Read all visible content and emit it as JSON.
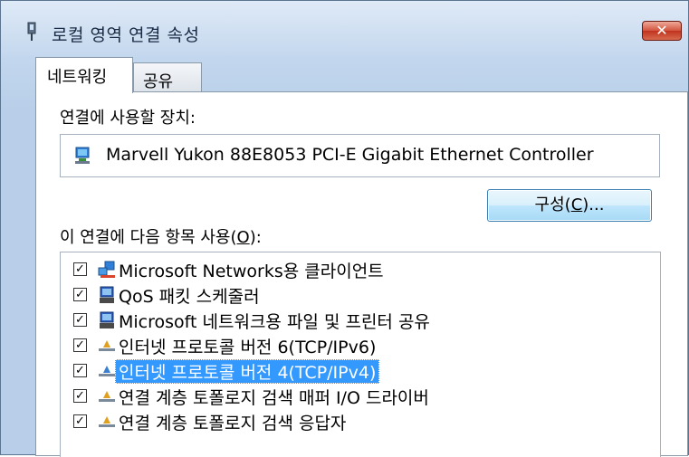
{
  "window": {
    "title": "로컬 영역 연결 속성",
    "close_label": "✕"
  },
  "tabs": [
    {
      "label": "네트워킹",
      "active": true
    },
    {
      "label": "공유",
      "active": false
    }
  ],
  "connection": {
    "device_label": "연결에 사용할 장치:",
    "device_name": "Marvell Yukon 88E8053 PCI-E Gigabit Ethernet Controller",
    "configure_prefix": "구성(",
    "configure_key": "C",
    "configure_suffix": ")..."
  },
  "items_section": {
    "label_prefix": "이 연결에 다음 항목 사용(",
    "label_key": "O",
    "label_suffix": "):"
  },
  "items": [
    {
      "label": "Microsoft Networks용 클라이언트",
      "checked": true,
      "icon": "network-client-icon",
      "selected": false
    },
    {
      "label": "QoS 패킷 스케줄러",
      "checked": true,
      "icon": "service-icon",
      "selected": false
    },
    {
      "label": "Microsoft 네트워크용 파일 및 프린터 공유",
      "checked": true,
      "icon": "service-icon",
      "selected": false
    },
    {
      "label": "인터넷 프로토콜 버전 6(TCP/IPv6)",
      "checked": true,
      "icon": "protocol-icon",
      "selected": false
    },
    {
      "label": "인터넷 프로토콜 버전 4(TCP/IPv4)",
      "checked": true,
      "icon": "protocol-icon",
      "selected": true
    },
    {
      "label": "연결 계층 토폴로지 검색 매퍼 I/O 드라이버",
      "checked": true,
      "icon": "protocol-icon",
      "selected": false
    },
    {
      "label": "연결 계층 토폴로지 검색 응답자",
      "checked": true,
      "icon": "protocol-icon",
      "selected": false
    }
  ],
  "colors": {
    "selection": "#3399ff",
    "close_button": "#c0331f",
    "accent_button": "#bee6fd"
  }
}
